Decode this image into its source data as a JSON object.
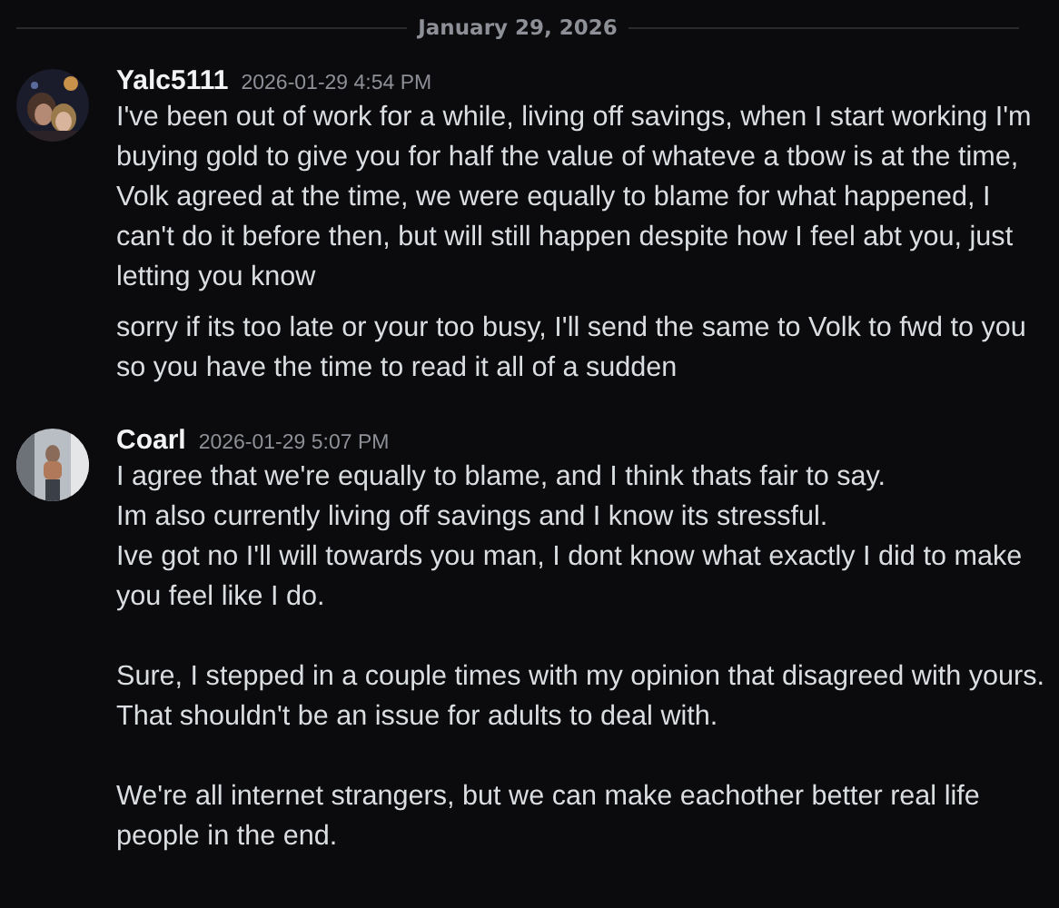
{
  "date_divider": "January 29, 2026",
  "messages": [
    {
      "author": "Yalc5111",
      "timestamp": "2026-01-29 4:54 PM",
      "contents": [
        {
          "paragraphs": [
            "I've been out of work for a while, living off savings, when I start working I'm buying gold to give you for half the value of whateve a tbow is at the time, Volk agreed at the time, we were equally to blame for what happened, I can't do it before then, but will still happen despite how I feel abt you, just letting you know"
          ]
        },
        {
          "paragraphs": [
            "sorry if its too late or your too busy, I'll send the same to Volk to fwd to you so you have the time to read it all of a sudden"
          ]
        }
      ]
    },
    {
      "author": "Coarl",
      "timestamp": "2026-01-29 5:07 PM",
      "contents": [
        {
          "paragraphs": [
            "I agree that we're equally to blame, and I think thats fair to say.\nIm also currently living off savings and I know its stressful.\nIve got no I'll will towards you man, I dont know what exactly I did to make you feel like I do.",
            "Sure, I stepped in a couple times with my opinion that disagreed with yours. That shouldn't be an issue for adults to deal with.",
            "We're all internet strangers, but we can make eachother better real life people in the end."
          ]
        }
      ]
    }
  ]
}
